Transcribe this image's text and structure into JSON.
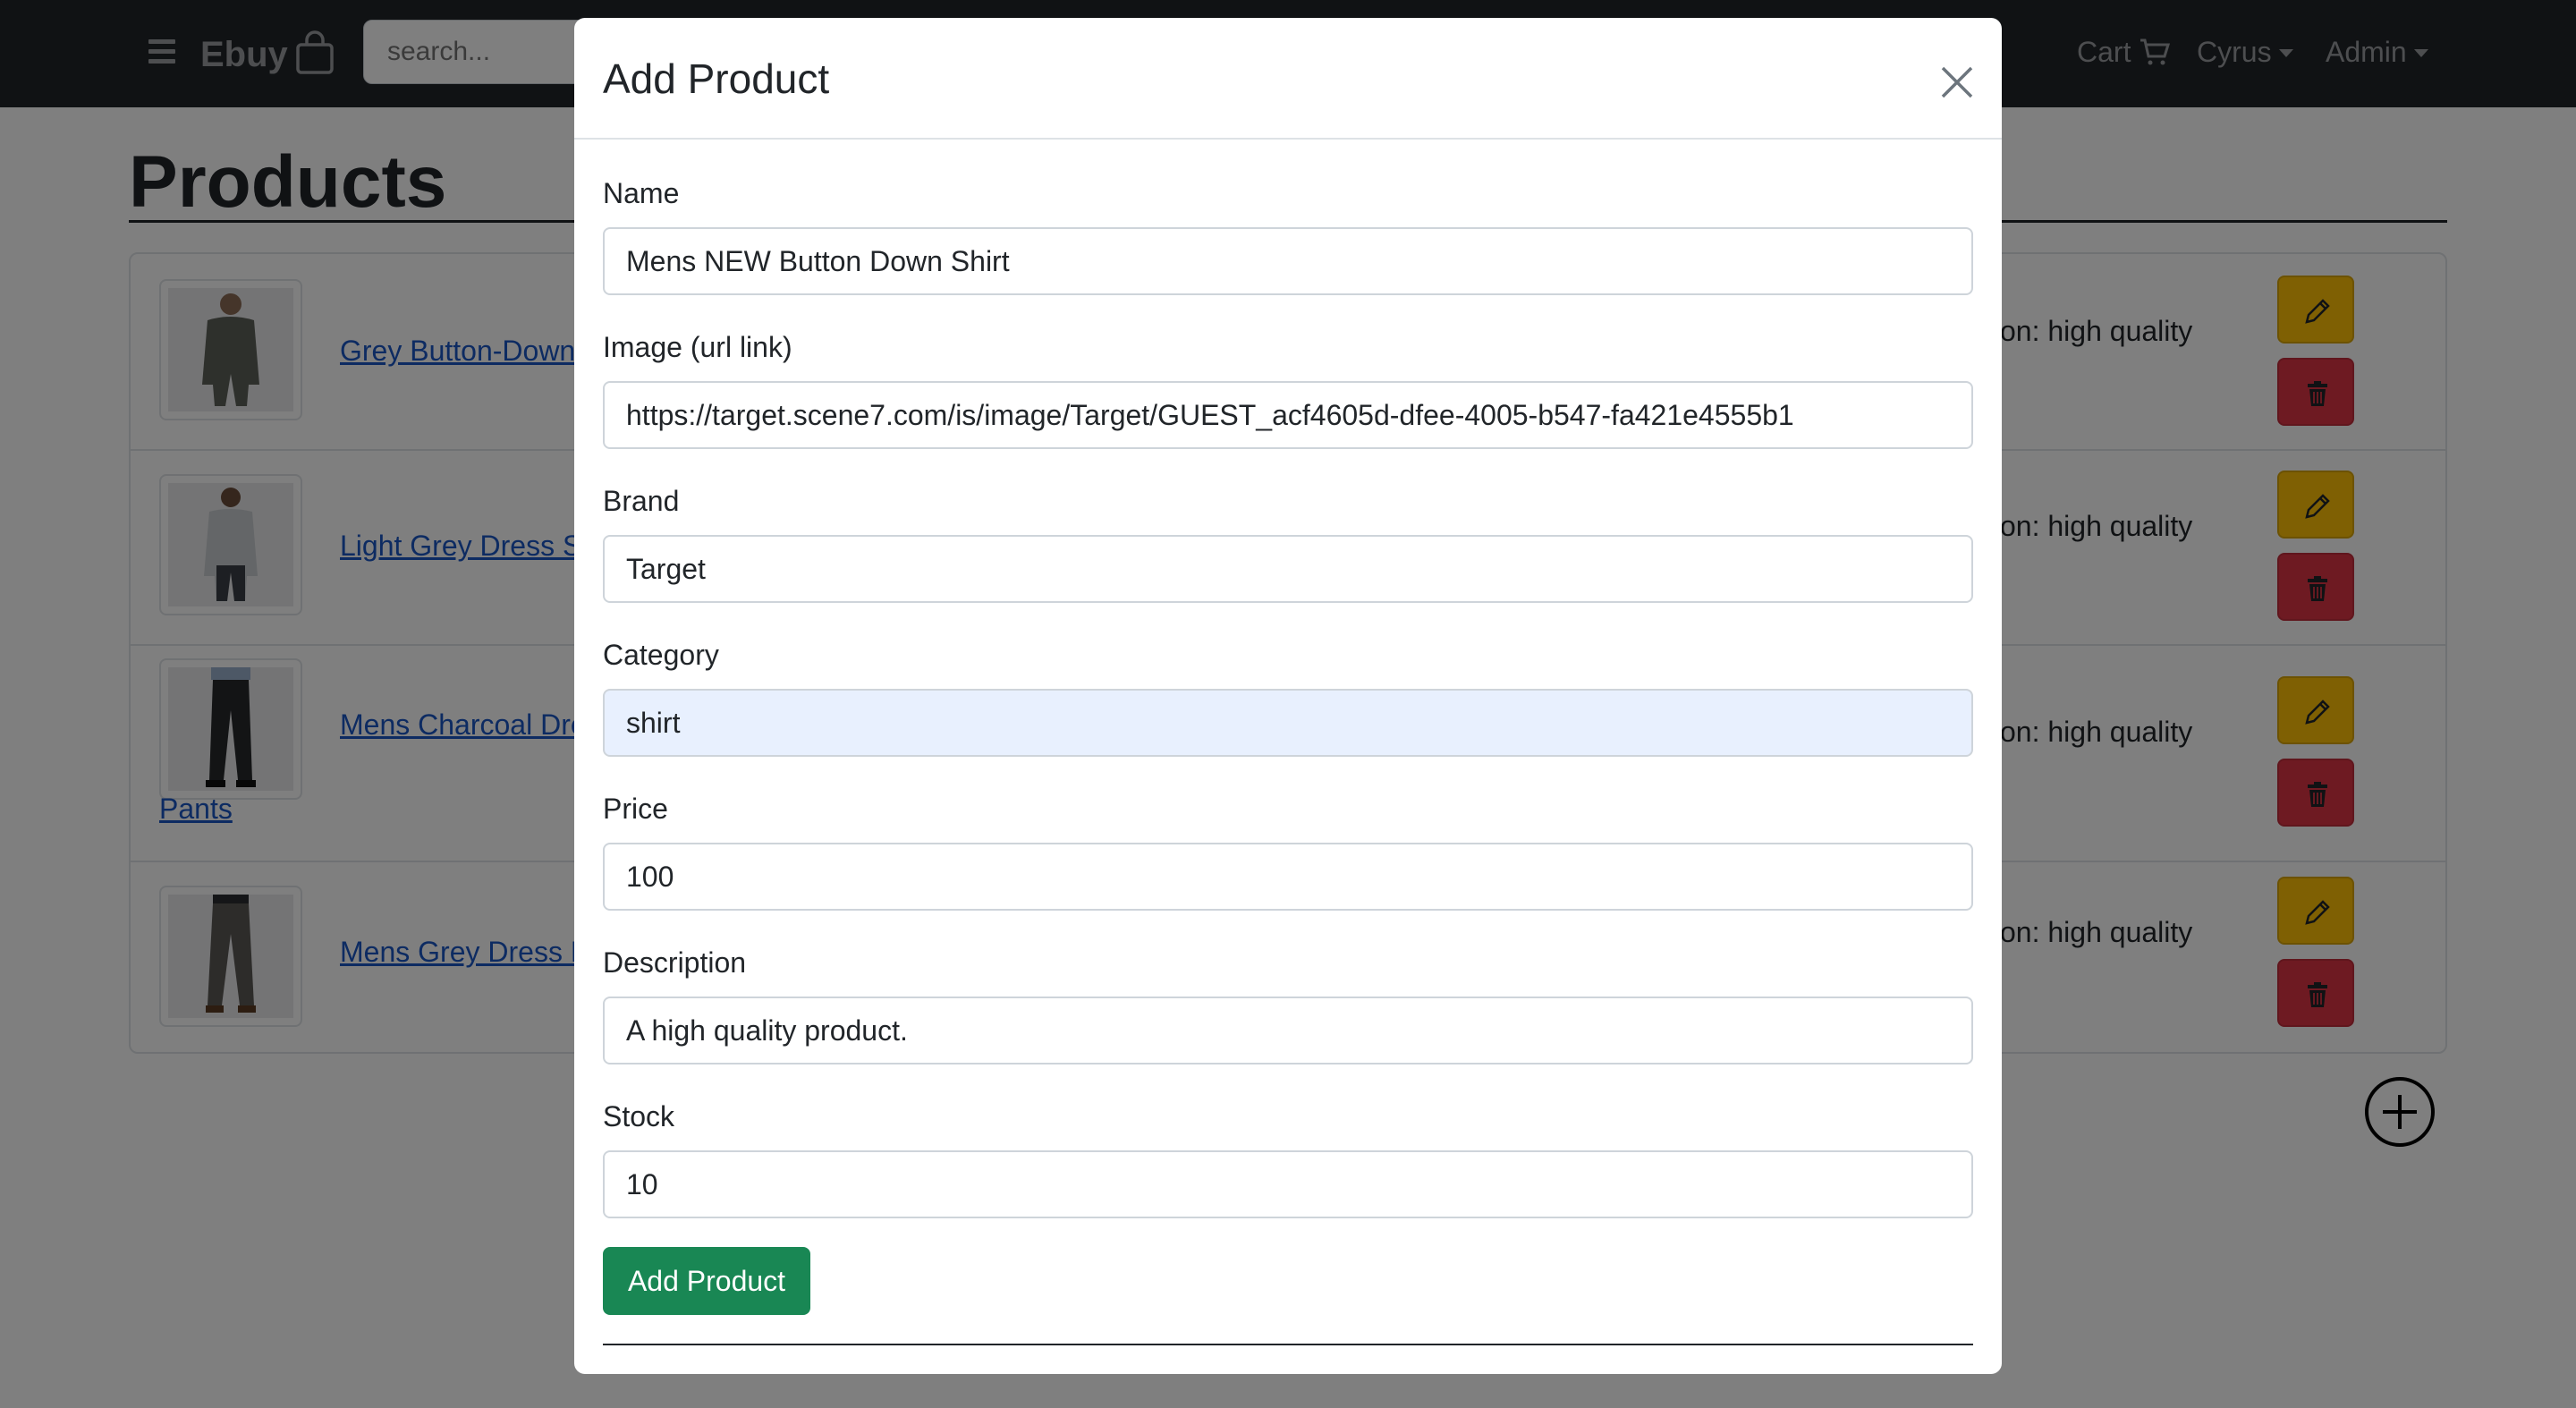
{
  "navbar": {
    "brand": "Ebuy",
    "search_placeholder": "search...",
    "cart_label": "Cart",
    "user_label": "Cyrus",
    "admin_label": "Admin"
  },
  "page": {
    "title": "Products",
    "products": [
      {
        "name": "Grey Button-Down",
        "description": "on: high quality"
      },
      {
        "name": "Light Grey Dress S",
        "description": "on: high quality"
      },
      {
        "name": "Mens Charcoal Dre",
        "name_continued": "Pants",
        "description": "on: high quality"
      },
      {
        "name": "Mens Grey Dress F",
        "description": "on: high quality"
      }
    ]
  },
  "modal": {
    "title": "Add Product",
    "fields": {
      "name": {
        "label": "Name",
        "value": "Mens NEW Button Down Shirt"
      },
      "image": {
        "label": "Image (url link)",
        "value": "https://target.scene7.com/is/image/Target/GUEST_acf4605d-dfee-4005-b547-fa421e4555b1"
      },
      "brand": {
        "label": "Brand",
        "value": "Target"
      },
      "category": {
        "label": "Category",
        "value": "shirt"
      },
      "price": {
        "label": "Price",
        "value": "100"
      },
      "description": {
        "label": "Description",
        "value": "A high quality product."
      },
      "stock": {
        "label": "Stock",
        "value": "10"
      }
    },
    "submit_label": "Add Product"
  },
  "colors": {
    "navbar_bg": "#212529",
    "link": "#1a56c4",
    "edit_button": "#ffc107",
    "delete_button": "#dc3545",
    "submit_button": "#198754",
    "autofill_bg": "#e8f0fe"
  }
}
